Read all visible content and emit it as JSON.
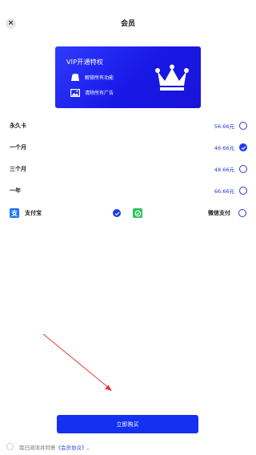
{
  "header": {
    "close_glyph": "×",
    "title": "会员"
  },
  "banner": {
    "title": "VIP开通特权",
    "benefits": [
      {
        "icon": "bag-icon",
        "text": "解锁所有功能"
      },
      {
        "icon": "image-icon",
        "text": "清除所有广告"
      }
    ],
    "crown_icon": "crown-icon"
  },
  "plans": [
    {
      "name": "永久卡",
      "price": "56.66元",
      "selected": false
    },
    {
      "name": "一个月",
      "price": "46.66元",
      "selected": true
    },
    {
      "name": "三个月",
      "price": "48.66元",
      "selected": false
    },
    {
      "name": "一年",
      "price": "66.66元",
      "selected": false
    }
  ],
  "payment": {
    "alipay": {
      "glyph": "支",
      "label": "支付宝",
      "selected": true
    },
    "wechat": {
      "label": "微信支付",
      "selected": false
    }
  },
  "buy_button": "立即购买",
  "agreement": {
    "prefix": "我已阅读并同意",
    "link": "《会员协议》",
    "suffix": "。"
  },
  "colors": {
    "accent": "#1430f0",
    "price": "#2436c9",
    "alipay": "#1677ff",
    "wechat": "#29c35b",
    "annotation": "#e53935"
  }
}
